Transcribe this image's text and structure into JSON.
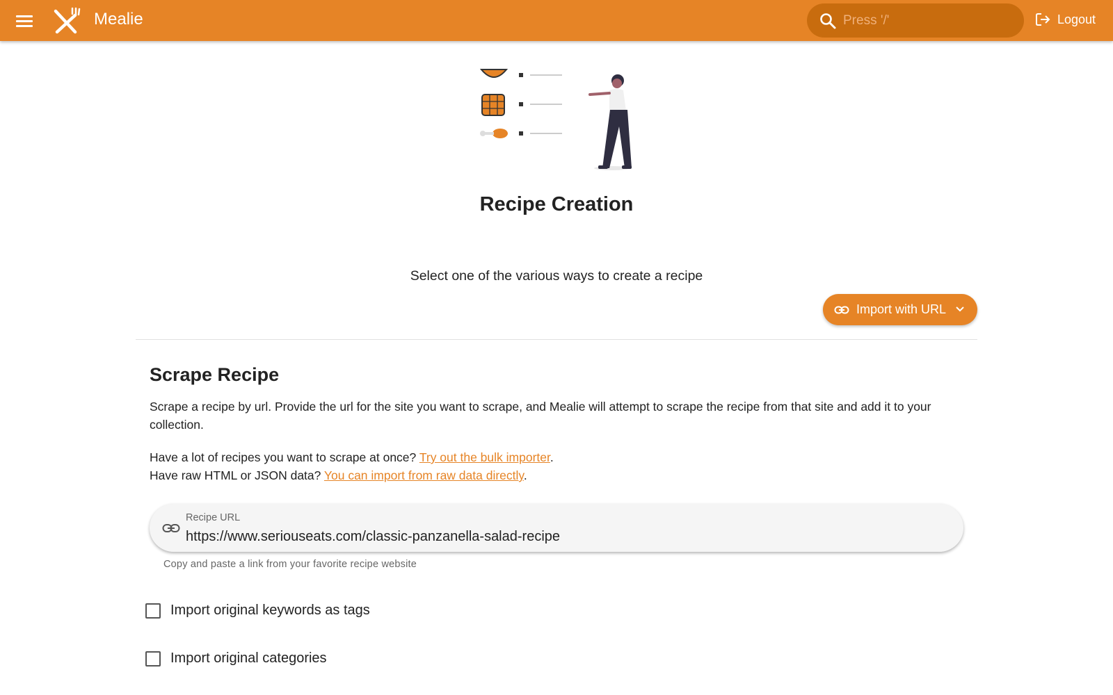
{
  "app": {
    "title": "Mealie",
    "search_placeholder": "Press '/'",
    "logout_label": "Logout"
  },
  "page": {
    "title": "Recipe Creation",
    "subtitle": "Select one of the various ways to create a recipe",
    "import_button_label": "Import with URL"
  },
  "scrape": {
    "title": "Scrape Recipe",
    "description": "Scrape a recipe by url. Provide the url for the site you want to scrape, and Mealie will attempt to scrape the recipe from that site and add it to your collection.",
    "bulk_prefix": "Have a lot of recipes you want to scrape at once? ",
    "bulk_link": "Try out the bulk importer",
    "bulk_suffix": ".",
    "raw_prefix": "Have raw HTML or JSON data? ",
    "raw_link": "You can import from raw data directly",
    "raw_suffix": ".",
    "url_label": "Recipe URL",
    "url_value": "https://www.seriouseats.com/classic-panzanella-salad-recipe",
    "url_hint": "Copy and paste a link from your favorite recipe website"
  },
  "options": [
    {
      "label": "Import original keywords as tags",
      "checked": false
    },
    {
      "label": "Import original categories",
      "checked": false
    }
  ],
  "colors": {
    "primary": "#e68426",
    "search_bg": "#c86c0e"
  },
  "icons": [
    "menu-icon",
    "fork-knife-logo-icon",
    "search-icon",
    "logout-icon",
    "link-icon",
    "chevron-down-icon"
  ]
}
